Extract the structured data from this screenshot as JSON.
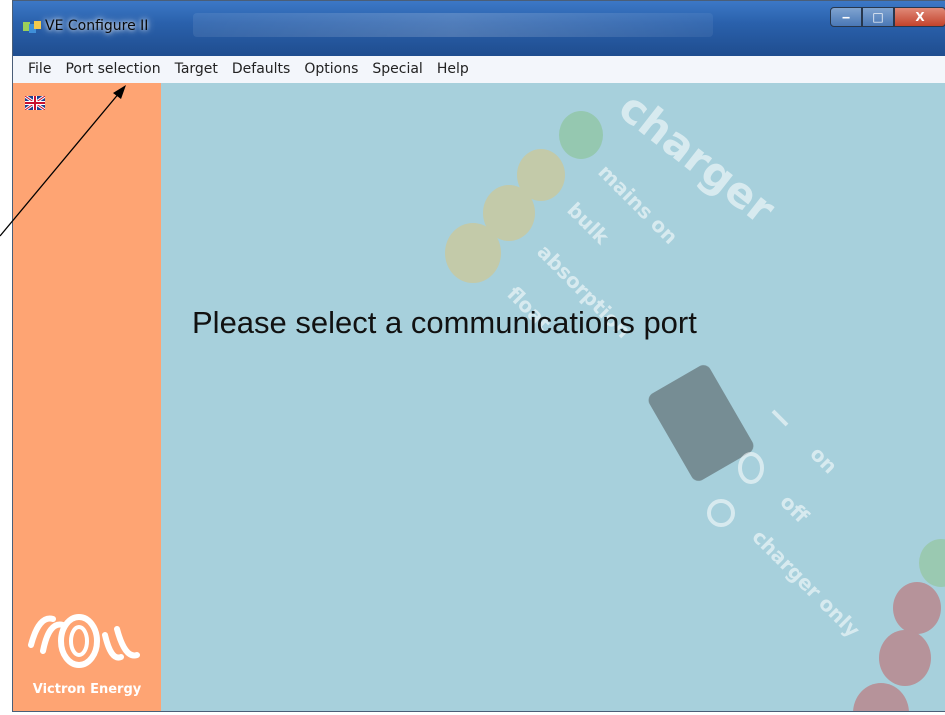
{
  "window": {
    "title": "VE Configure II",
    "controls": {
      "minimize": "‒",
      "maximize": "□",
      "close": "X"
    }
  },
  "menubar": {
    "items": [
      "File",
      "Port selection",
      "Target",
      "Defaults",
      "Options",
      "Special",
      "Help"
    ]
  },
  "sidebar": {
    "language_icon": "uk-flag-icon",
    "logo_text": "Victron Energy",
    "color": "#fea473"
  },
  "main": {
    "message": "Please select a communications port",
    "background_color": "#a7d0dc",
    "artwork_text": {
      "charger": "charger",
      "mains_on": "mains on",
      "bulk": "bulk",
      "absorption": "absorption",
      "float": "float",
      "on": "on",
      "off": "off",
      "charger_only": "charger only"
    }
  },
  "annotation": {
    "icon": "arrow-icon",
    "target": "Port selection"
  }
}
